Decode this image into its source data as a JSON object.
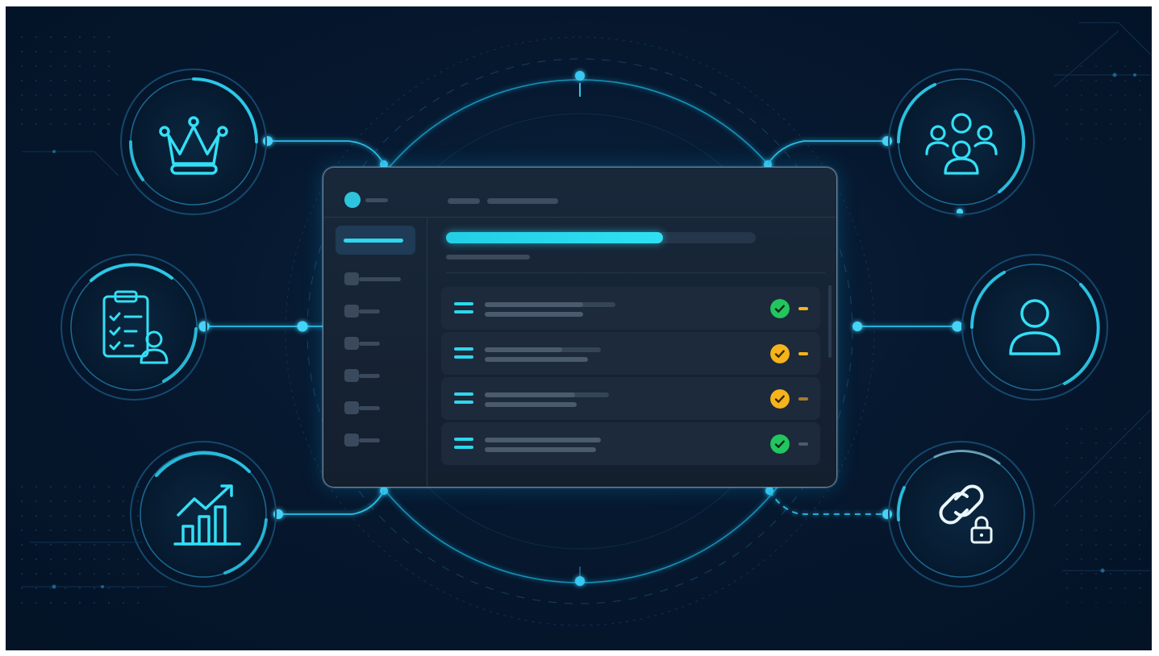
{
  "colors": {
    "background": "#06182f",
    "accent": "#22d3ee",
    "glow": "#38bdf8",
    "success": "#22c55e",
    "warning": "#f5b31c",
    "window": "#16232f"
  },
  "nodes": [
    {
      "name": "crown",
      "icon": "crown-icon"
    },
    {
      "name": "checklist-user",
      "icon": "clipboard-checklist-user-icon"
    },
    {
      "name": "growth-chart",
      "icon": "bar-chart-trend-icon"
    },
    {
      "name": "team",
      "icon": "user-group-icon"
    },
    {
      "name": "user",
      "icon": "user-icon"
    },
    {
      "name": "secure-link",
      "icon": "link-lock-icon"
    }
  ],
  "window": {
    "progress": 0.7,
    "sidebar_items": 6,
    "rows": [
      {
        "status": "success",
        "icon": "check-icon"
      },
      {
        "status": "warning",
        "icon": "check-icon"
      },
      {
        "status": "warning",
        "icon": "check-icon"
      },
      {
        "status": "success",
        "icon": "check-icon"
      }
    ]
  }
}
